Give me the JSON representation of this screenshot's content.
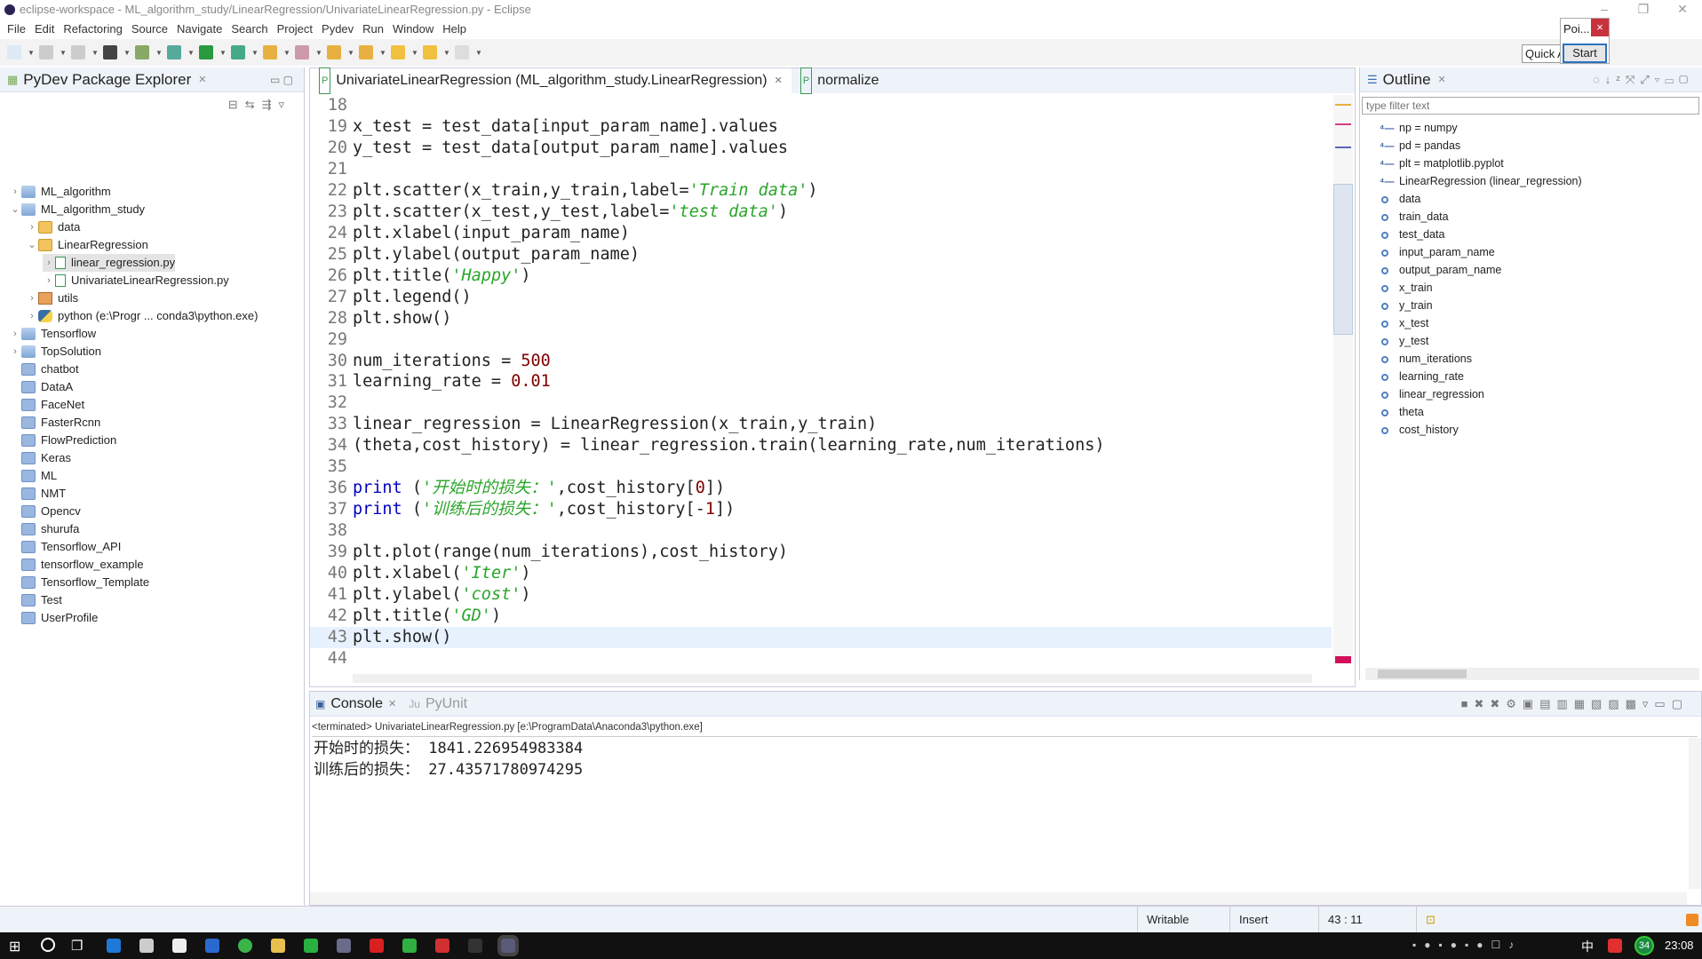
{
  "window": {
    "title": "eclipse-workspace - ML_algorithm_study/LinearRegression/UnivariateLinearRegression.py - Eclipse"
  },
  "menu": [
    "File",
    "Edit",
    "Refactoring",
    "Source",
    "Navigate",
    "Search",
    "Project",
    "Pydev",
    "Run",
    "Window",
    "Help"
  ],
  "popup": {
    "title": "Poi...",
    "close": "×",
    "start": "Start"
  },
  "quick_access": "Quick A",
  "explorer": {
    "title": "PyDev Package Explorer",
    "items": [
      {
        "label": "ML_algorithm",
        "level": 0,
        "arrow": "›",
        "icon": "project-icon"
      },
      {
        "label": "ML_algorithm_study",
        "level": 0,
        "arrow": "⌄",
        "icon": "project-icon"
      },
      {
        "label": "data",
        "level": 1,
        "arrow": "›",
        "icon": "folder-open-icon"
      },
      {
        "label": "LinearRegression",
        "level": 1,
        "arrow": "⌄",
        "icon": "folder-open-icon"
      },
      {
        "label": "linear_regression.py",
        "level": 2,
        "arrow": "›",
        "icon": "python-file-icon",
        "selected": true
      },
      {
        "label": "UnivariateLinearRegression.py",
        "level": 2,
        "arrow": "›",
        "icon": "python-file-icon"
      },
      {
        "label": "utils",
        "level": 1,
        "arrow": "›",
        "icon": "package-icon"
      },
      {
        "label": "python  (e:\\Progr ... conda3\\python.exe)",
        "level": 1,
        "arrow": "›",
        "icon": "python-interpreter-icon"
      },
      {
        "label": "Tensorflow",
        "level": 0,
        "arrow": "›",
        "icon": "project-icon"
      },
      {
        "label": "TopSolution",
        "level": 0,
        "arrow": "›",
        "icon": "project-icon"
      },
      {
        "label": "chatbot",
        "level": 0,
        "arrow": "",
        "icon": "folder-icon"
      },
      {
        "label": "DataA",
        "level": 0,
        "arrow": "",
        "icon": "folder-icon"
      },
      {
        "label": "FaceNet",
        "level": 0,
        "arrow": "",
        "icon": "folder-icon"
      },
      {
        "label": "FasterRcnn",
        "level": 0,
        "arrow": "",
        "icon": "folder-icon"
      },
      {
        "label": "FlowPrediction",
        "level": 0,
        "arrow": "",
        "icon": "folder-icon"
      },
      {
        "label": "Keras",
        "level": 0,
        "arrow": "",
        "icon": "folder-icon"
      },
      {
        "label": "ML",
        "level": 0,
        "arrow": "",
        "icon": "folder-icon"
      },
      {
        "label": "NMT",
        "level": 0,
        "arrow": "",
        "icon": "folder-icon"
      },
      {
        "label": "Opencv",
        "level": 0,
        "arrow": "",
        "icon": "folder-icon"
      },
      {
        "label": "shurufa",
        "level": 0,
        "arrow": "",
        "icon": "folder-icon"
      },
      {
        "label": "Tensorflow_API",
        "level": 0,
        "arrow": "",
        "icon": "folder-icon"
      },
      {
        "label": "tensorflow_example",
        "level": 0,
        "arrow": "",
        "icon": "folder-icon"
      },
      {
        "label": "Tensorflow_Template",
        "level": 0,
        "arrow": "",
        "icon": "folder-icon"
      },
      {
        "label": "Test",
        "level": 0,
        "arrow": "",
        "icon": "folder-icon"
      },
      {
        "label": "UserProfile",
        "level": 0,
        "arrow": "",
        "icon": "folder-icon"
      }
    ]
  },
  "editor": {
    "tabs": [
      {
        "label": "UnivariateLinearRegression (ML_algorithm_study.LinearRegression)",
        "close": "✕",
        "active": true
      },
      {
        "label": "normalize",
        "active": false
      }
    ],
    "current_line": 43,
    "lines": [
      {
        "n": "18",
        "seg": []
      },
      {
        "n": "19",
        "seg": [
          [
            "p",
            "x_test = test_data[input_param_name].values"
          ]
        ]
      },
      {
        "n": "20",
        "seg": [
          [
            "p",
            "y_test = test_data[output_param_name].values"
          ]
        ]
      },
      {
        "n": "21",
        "seg": []
      },
      {
        "n": "22",
        "seg": [
          [
            "p",
            "plt.scatter(x_train,y_train,label="
          ],
          [
            "s",
            "'Train data'"
          ],
          [
            "p",
            ")"
          ]
        ]
      },
      {
        "n": "23",
        "seg": [
          [
            "p",
            "plt.scatter(x_test,y_test,label="
          ],
          [
            "s",
            "'test data'"
          ],
          [
            "p",
            ")"
          ]
        ]
      },
      {
        "n": "24",
        "seg": [
          [
            "p",
            "plt.xlabel(input_param_name)"
          ]
        ]
      },
      {
        "n": "25",
        "seg": [
          [
            "p",
            "plt.ylabel(output_param_name)"
          ]
        ]
      },
      {
        "n": "26",
        "seg": [
          [
            "p",
            "plt.title("
          ],
          [
            "s",
            "'Happy'"
          ],
          [
            "p",
            ")"
          ]
        ]
      },
      {
        "n": "27",
        "seg": [
          [
            "p",
            "plt.legend()"
          ]
        ]
      },
      {
        "n": "28",
        "seg": [
          [
            "p",
            "plt.show()"
          ]
        ]
      },
      {
        "n": "29",
        "seg": []
      },
      {
        "n": "30",
        "seg": [
          [
            "p",
            "num_iterations = "
          ],
          [
            "n",
            "500"
          ]
        ]
      },
      {
        "n": "31",
        "seg": [
          [
            "p",
            "learning_rate = "
          ],
          [
            "n",
            "0.01"
          ]
        ]
      },
      {
        "n": "32",
        "seg": []
      },
      {
        "n": "33",
        "seg": [
          [
            "p",
            "linear_regression = LinearRegression(x_train,y_train)"
          ]
        ]
      },
      {
        "n": "34",
        "seg": [
          [
            "p",
            "(theta,cost_history) = linear_regression.train(learning_rate,num_iterations)"
          ]
        ]
      },
      {
        "n": "35",
        "seg": []
      },
      {
        "n": "36",
        "seg": [
          [
            "k",
            "print"
          ],
          [
            "p",
            " ("
          ],
          [
            "s",
            "'开始时的损失：'"
          ],
          [
            "p",
            ",cost_history["
          ],
          [
            "n",
            "0"
          ],
          [
            "p",
            "])"
          ]
        ]
      },
      {
        "n": "37",
        "seg": [
          [
            "k",
            "print"
          ],
          [
            "p",
            " ("
          ],
          [
            "s",
            "'训练后的损失：'"
          ],
          [
            "p",
            ",cost_history[-"
          ],
          [
            "n",
            "1"
          ],
          [
            "p",
            "])"
          ]
        ]
      },
      {
        "n": "38",
        "seg": []
      },
      {
        "n": "39",
        "seg": [
          [
            "p",
            "plt.plot(range(num_iterations),cost_history)"
          ]
        ]
      },
      {
        "n": "40",
        "seg": [
          [
            "p",
            "plt.xlabel("
          ],
          [
            "s",
            "'Iter'"
          ],
          [
            "p",
            ")"
          ]
        ]
      },
      {
        "n": "41",
        "seg": [
          [
            "p",
            "plt.ylabel("
          ],
          [
            "s",
            "'cost'"
          ],
          [
            "p",
            ")"
          ]
        ]
      },
      {
        "n": "42",
        "seg": [
          [
            "p",
            "plt.title("
          ],
          [
            "s",
            "'GD'"
          ],
          [
            "p",
            ")"
          ]
        ]
      },
      {
        "n": "43",
        "seg": [
          [
            "p",
            "plt.show()"
          ]
        ]
      },
      {
        "n": "44",
        "seg": []
      }
    ]
  },
  "outline": {
    "title": "Outline",
    "filter_placeholder": "type filter text",
    "items": [
      {
        "label": "np = numpy",
        "kind": "import"
      },
      {
        "label": "pd = pandas",
        "kind": "import"
      },
      {
        "label": "plt = matplotlib.pyplot",
        "kind": "import"
      },
      {
        "label": "LinearRegression (linear_regression)",
        "kind": "import"
      },
      {
        "label": "data",
        "kind": "var"
      },
      {
        "label": "train_data",
        "kind": "var"
      },
      {
        "label": "test_data",
        "kind": "var"
      },
      {
        "label": "input_param_name",
        "kind": "var"
      },
      {
        "label": "output_param_name",
        "kind": "var"
      },
      {
        "label": "x_train",
        "kind": "var"
      },
      {
        "label": "y_train",
        "kind": "var"
      },
      {
        "label": "x_test",
        "kind": "var"
      },
      {
        "label": "y_test",
        "kind": "var"
      },
      {
        "label": "num_iterations",
        "kind": "var"
      },
      {
        "label": "learning_rate",
        "kind": "var"
      },
      {
        "label": "linear_regression",
        "kind": "var"
      },
      {
        "label": "theta",
        "kind": "var"
      },
      {
        "label": "cost_history",
        "kind": "var"
      }
    ]
  },
  "console": {
    "tabs": [
      "Console",
      "PyUnit"
    ],
    "info": "<terminated> UnivariateLinearRegression.py [e:\\ProgramData\\Anaconda3\\python.exe]",
    "output": [
      "开始时的损失： 1841.226954983384",
      "训练后的损失： 27.43571780974295"
    ]
  },
  "status": {
    "writable": "Writable",
    "mode": "Insert",
    "position": "43 : 11"
  },
  "taskbar": {
    "clock": "23:08",
    "ime": "中",
    "badge": "34"
  }
}
